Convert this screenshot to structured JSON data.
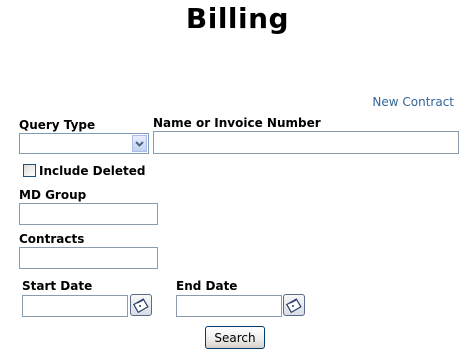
{
  "page": {
    "title": "Billing"
  },
  "links": {
    "new_contract": "New Contract"
  },
  "form": {
    "query_type": {
      "label": "Query Type",
      "value": "",
      "icon": "chevron-down-icon"
    },
    "name_or_invoice": {
      "label": "Name or Invoice Number",
      "value": ""
    },
    "include_deleted": {
      "label": "Include Deleted",
      "checked": false
    },
    "md_group": {
      "label": "MD Group",
      "value": ""
    },
    "contracts": {
      "label": "Contracts",
      "value": ""
    },
    "start_date": {
      "label": "Start Date",
      "value": "",
      "icon": "calendar-icon"
    },
    "end_date": {
      "label": "End Date",
      "value": "",
      "icon": "calendar-icon"
    },
    "search_button": "Search"
  }
}
